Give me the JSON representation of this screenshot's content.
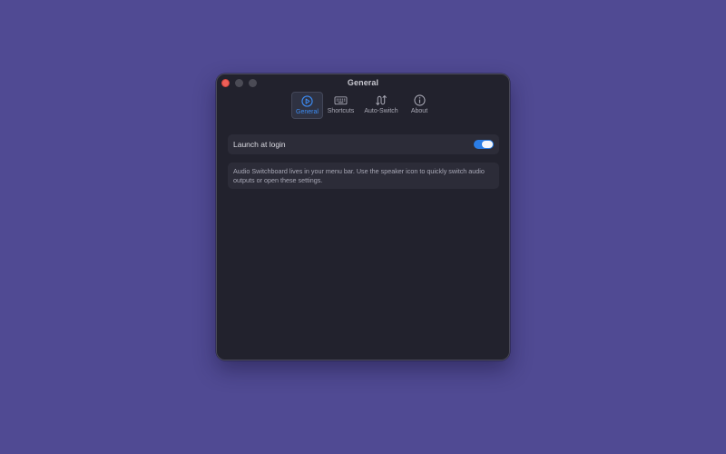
{
  "window": {
    "title": "General"
  },
  "toolbar": {
    "tabs": [
      {
        "label": "General",
        "icon": "play-circle-icon",
        "active": true
      },
      {
        "label": "Shortcuts",
        "icon": "keyboard-icon",
        "active": false
      },
      {
        "label": "Auto-Switch",
        "icon": "auto-switch-arrows-icon",
        "active": false
      },
      {
        "label": "About",
        "icon": "info-circle-icon",
        "active": false
      }
    ]
  },
  "settings": {
    "launch_at_login": {
      "label": "Launch at login",
      "enabled": true
    },
    "info_text": "Audio Switchboard lives in your menu bar. Use the speaker icon to quickly switch audio outputs or open these settings."
  },
  "colors": {
    "desktop": "#504a93",
    "window_bg": "#22222d",
    "accent": "#3c8cf5",
    "close_button": "#ee5f58"
  }
}
